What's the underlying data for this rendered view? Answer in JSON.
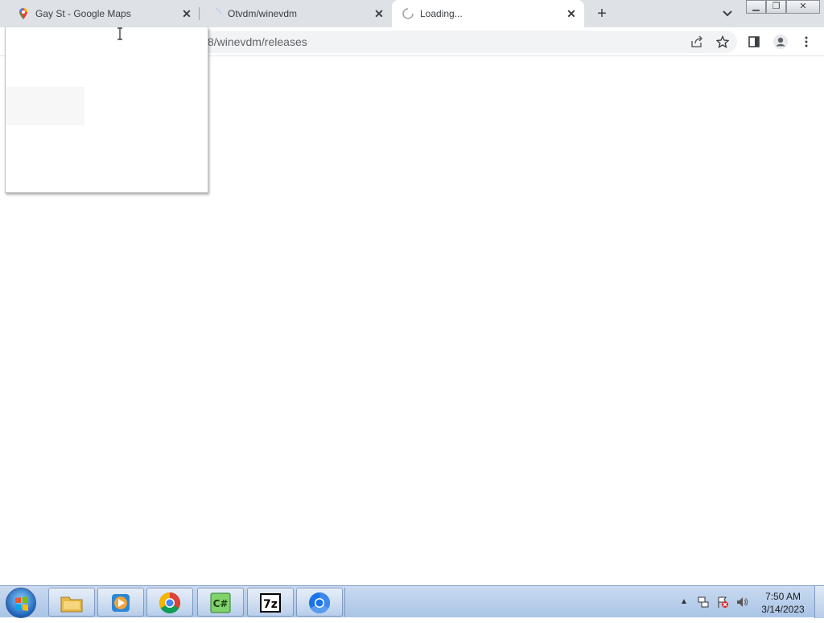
{
  "browser": {
    "tabs": [
      {
        "title": "Gay St - Google Maps",
        "icon": "google-maps-icon",
        "active": false
      },
      {
        "title": "Otvdm/winevdm",
        "icon": "loading-spinner-icon",
        "active": false
      },
      {
        "title": "Loading...",
        "icon": "loading-spinner-icon",
        "active": true
      }
    ],
    "new_tab_label": "+",
    "close_glyph": "✕",
    "address": "8/winevdm/releases"
  },
  "window_controls": {
    "minimize": "▁",
    "restore": "❐",
    "close": "✕"
  },
  "taskbar": {
    "apps": [
      {
        "name": "file-explorer"
      },
      {
        "name": "media-player"
      },
      {
        "name": "google-chrome"
      },
      {
        "name": "csharp-app",
        "label": "C#"
      },
      {
        "name": "7zip",
        "label": "7z"
      },
      {
        "name": "chromium"
      }
    ],
    "clock": {
      "time": "7:50 AM",
      "date": "3/14/2023"
    }
  },
  "colors": {
    "tabstrip": "#dee1e6",
    "omnibox": "#f1f3f4",
    "taskbar": "#b5cbe8"
  }
}
